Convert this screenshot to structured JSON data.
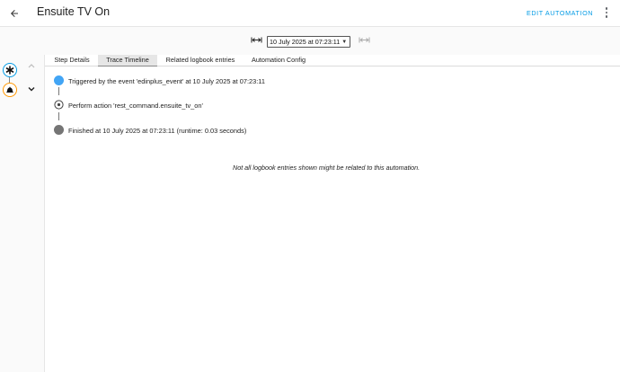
{
  "header": {
    "title": "Ensuite TV On",
    "edit_label": "EDIT AUTOMATION",
    "back_icon": "arrow-left-icon",
    "more_icon": "dots-vertical-icon"
  },
  "trace_nav": {
    "selected": "10 July 2025 at 07:23:11",
    "prev_icon": "arrow-collapse-left-icon",
    "next_icon": "arrow-collapse-right-icon"
  },
  "tabs": [
    {
      "label": "Step Details",
      "active": false
    },
    {
      "label": "Trace Timeline",
      "active": true
    },
    {
      "label": "Related logbook entries",
      "active": false
    },
    {
      "label": "Automation Config",
      "active": false
    }
  ],
  "timeline": [
    {
      "text": "Triggered by the event 'edinplus_event' at 10 July 2025 at 07:23:11",
      "icon": "filled-circle-icon",
      "color": "#42a5f5"
    },
    {
      "text": "Perform action 'rest_command.ensuite_tv_on'",
      "icon": "target-circle-icon",
      "color": "#424242"
    },
    {
      "text": "Finished at 10 July 2025 at 07:23:11 (runtime: 0.03 seconds)",
      "icon": "filled-circle-icon",
      "color": "#757575"
    }
  ],
  "note": "Not all logbook entries shown might be related to this automation.",
  "graph": {
    "trigger_icon": "asterisk-icon",
    "action_icon": "bell-icon",
    "trigger_color": "#039be5",
    "action_color": "#ff9800",
    "up_icon": "chevron-up-icon",
    "down_icon": "chevron-down-icon"
  },
  "colors": {
    "accent": "#039be5"
  }
}
